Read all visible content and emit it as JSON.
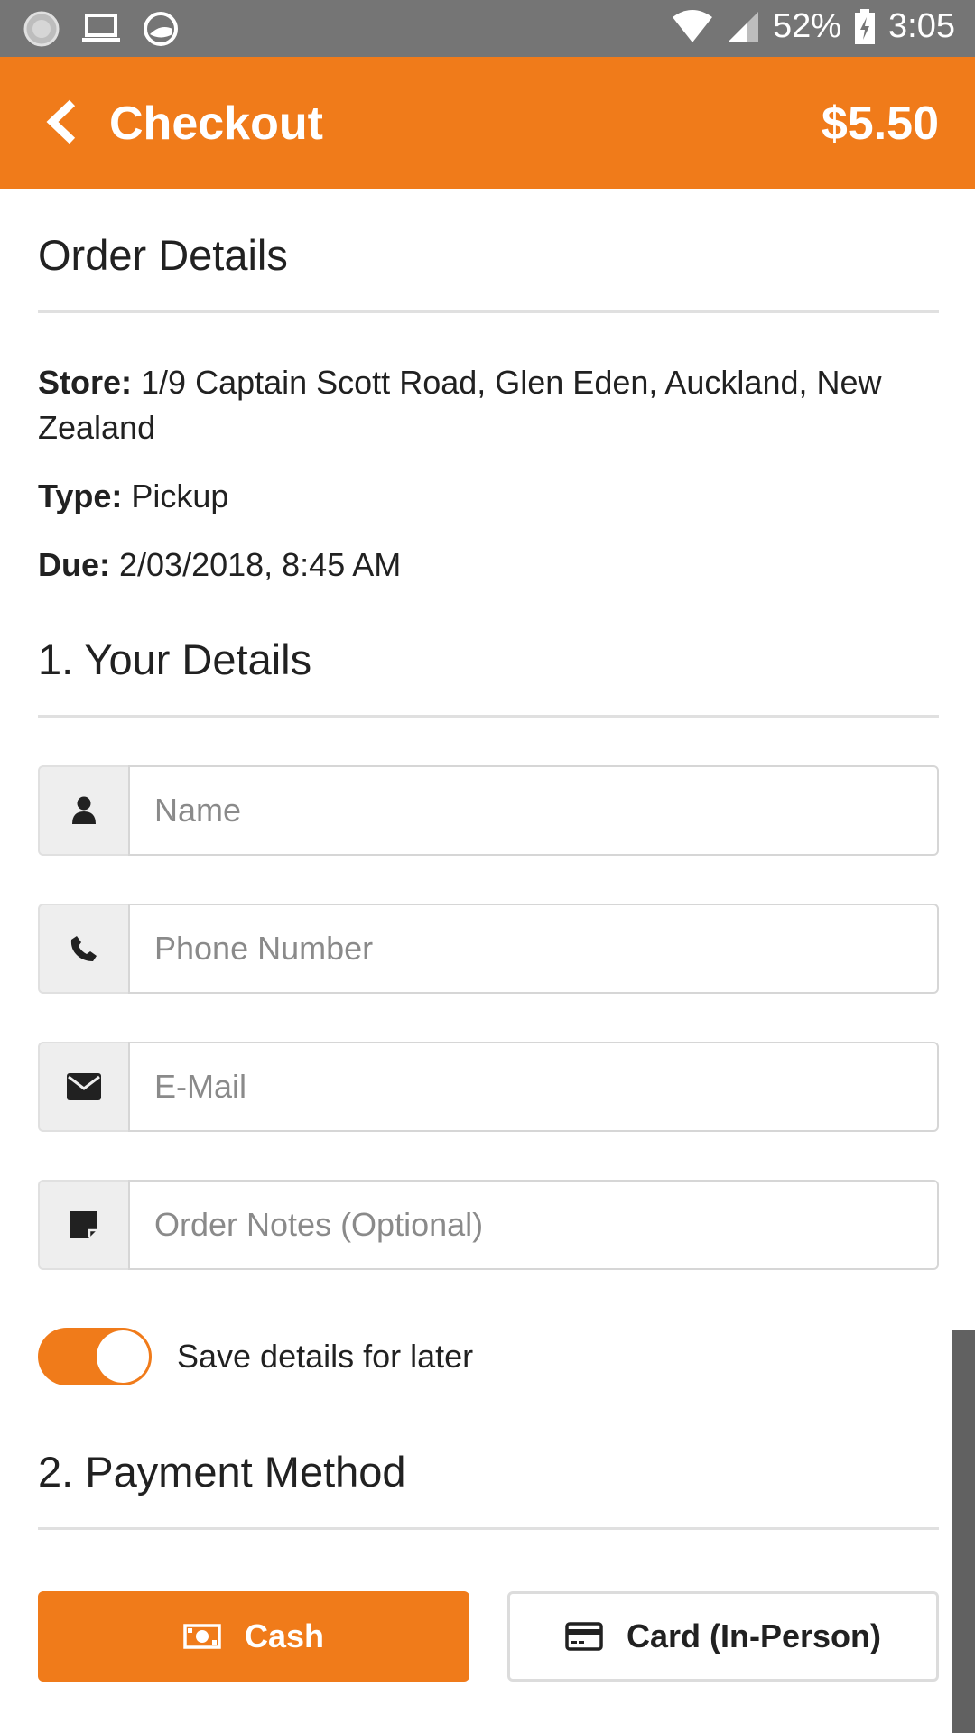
{
  "status_bar": {
    "icons_left": [
      "notification-dot-icon",
      "laptop-icon",
      "app-logo-icon"
    ],
    "battery": "52%",
    "time": "3:05",
    "icons_right": [
      "wifi-icon",
      "cellular-icon",
      "battery-charging-icon"
    ]
  },
  "app_bar": {
    "back_icon": "chevron-left-icon",
    "title": "Checkout",
    "total": "$5.50"
  },
  "order_details": {
    "title": "Order Details",
    "store_label": "Store:",
    "store_value": " 1/9 Captain Scott Road, Glen Eden, Auckland, New Zealand",
    "type_label": "Type:",
    "type_value": " Pickup",
    "due_label": "Due:",
    "due_value": " 2/03/2018, 8:45 AM"
  },
  "your_details": {
    "title": "1. Your Details",
    "fields": [
      {
        "icon": "user-icon",
        "placeholder": "Name",
        "value": ""
      },
      {
        "icon": "phone-icon",
        "placeholder": "Phone Number",
        "value": ""
      },
      {
        "icon": "envelope-icon",
        "placeholder": "E-Mail",
        "value": ""
      },
      {
        "icon": "sticky-note-icon",
        "placeholder": "Order Notes (Optional)",
        "value": ""
      }
    ],
    "save_toggle_on": true,
    "save_label": "Save details for later"
  },
  "payment": {
    "title": "2. Payment Method",
    "cash_label": "Cash",
    "cash_icon": "cash-icon",
    "card_label": "Card (In-Person)",
    "card_icon": "credit-card-icon",
    "selected": "Cash"
  },
  "colors": {
    "accent": "#f07b1a",
    "status_bar": "#757575",
    "divider": "#e0e0e0",
    "addon_bg": "#eeeeee"
  }
}
